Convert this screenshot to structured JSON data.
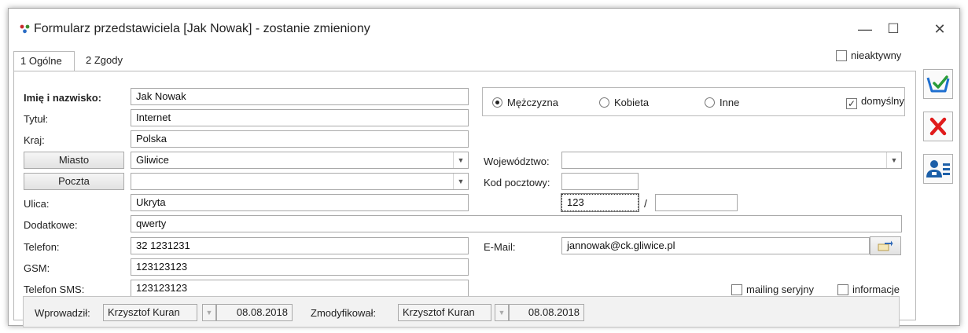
{
  "window": {
    "title": "Formularz przedstawiciela [Jak Nowak] - zostanie zmieniony",
    "minimize_glyph": "—",
    "maximize_glyph": "☐",
    "close_glyph": "✕"
  },
  "tabs": [
    {
      "label": "1 Ogólne",
      "active": true
    },
    {
      "label": "2 Zgody",
      "active": false
    }
  ],
  "nieaktywny": {
    "label": "nieaktywny",
    "checked": false
  },
  "form": {
    "imie_label": "Imię i nazwisko:",
    "imie_value": "Jak Nowak",
    "tytul_label": "Tytuł:",
    "tytul_value": "Internet",
    "kraj_label": "Kraj:",
    "kraj_value": "Polska",
    "miasto_button": "Miasto",
    "miasto_value": "Gliwice",
    "poczta_button": "Poczta",
    "poczta_value": "",
    "ulica_label": "Ulica:",
    "ulica_value": "Ukryta",
    "dodatkowe_label": "Dodatkowe:",
    "dodatkowe_value": "qwerty",
    "telefon_label": "Telefon:",
    "telefon_value": "32 1231231",
    "gsm_label": "GSM:",
    "gsm_value": "123123123",
    "sms_label": "Telefon SMS:",
    "sms_value": "123123123",
    "wojewodztwo_label": "Województwo:",
    "wojewodztwo_value": "",
    "kod_label": "Kod pocztowy:",
    "kod_value": "",
    "nr_domu_value": "123",
    "nr_separator": "/",
    "nr_lokalu_value": "",
    "email_label": "E-Mail:",
    "email_value": "jannowak@ck.gliwice.pl"
  },
  "gender": {
    "options": [
      "Mężczyzna",
      "Kobieta",
      "Inne"
    ],
    "selected": "Mężczyzna"
  },
  "domyslny": {
    "label": "domyślny",
    "checked": true
  },
  "mailing": {
    "label": "mailing seryjny",
    "checked": false
  },
  "informacje": {
    "label": "informacje",
    "checked": false
  },
  "footer": {
    "wprowadzil_label": "Wprowadził:",
    "wprowadzil_user": "Krzysztof Kuran",
    "wprowadzil_date": "08.08.2018",
    "zmodyfikowal_label": "Zmodyfikował:",
    "zmodyfikowal_user": "Krzysztof Kuran",
    "zmodyfikowal_date": "08.08.2018"
  },
  "colors": {
    "save_accent": "#1e6fd0",
    "cancel_red": "#e01b1b",
    "card_blue": "#1c5fa8"
  },
  "icons": [
    "save-icon",
    "cancel-icon",
    "contact-card-icon",
    "email-send-icon"
  ]
}
